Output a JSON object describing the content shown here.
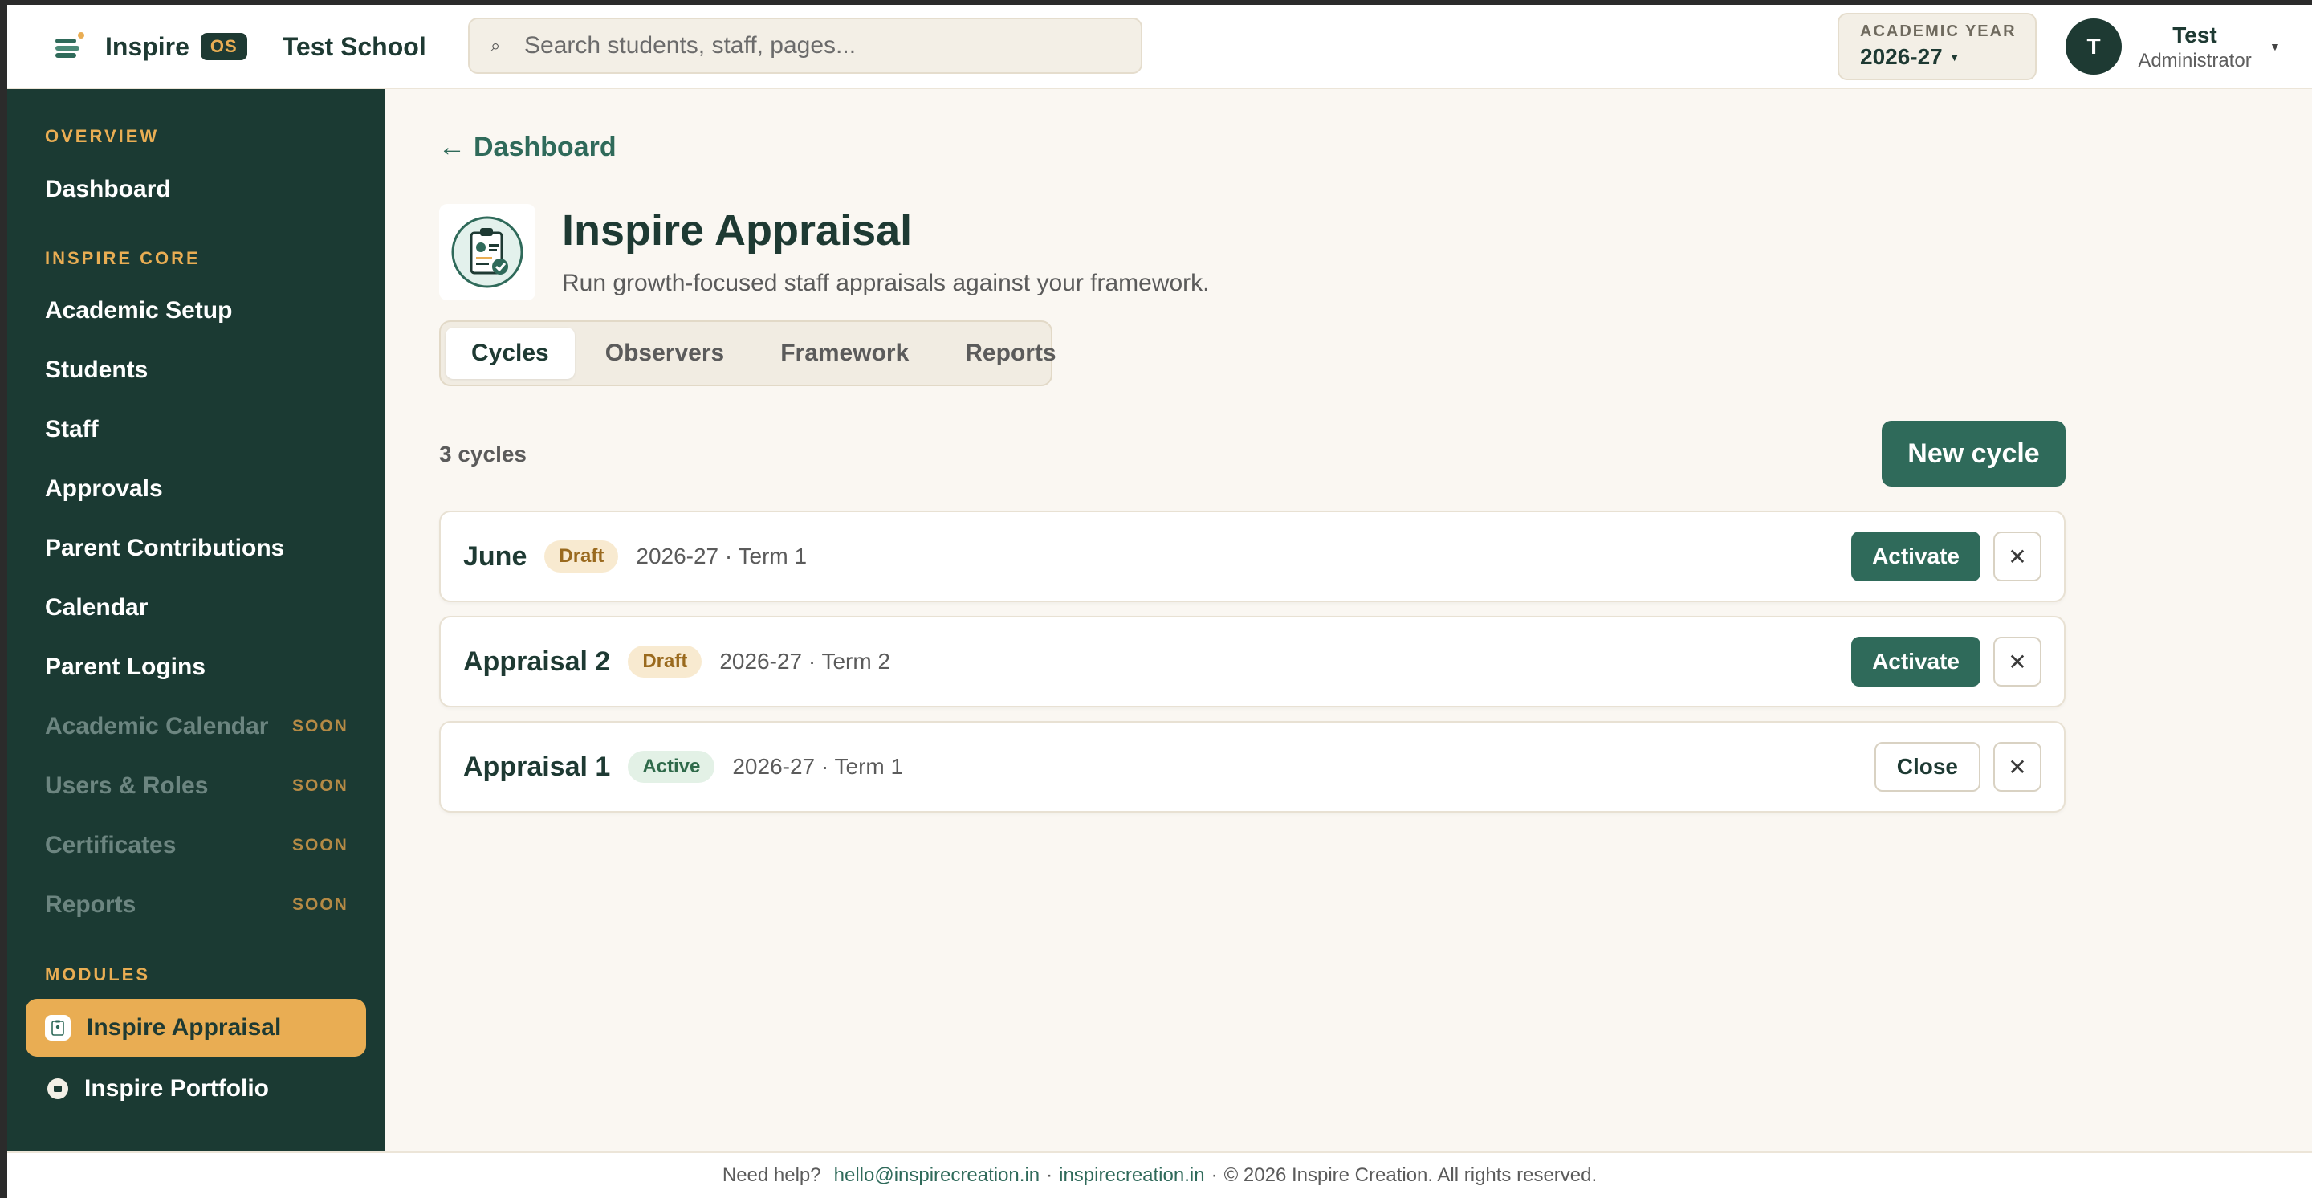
{
  "header": {
    "brand_name": "Inspire",
    "brand_badge": "OS",
    "school_name": "Test School",
    "search_placeholder": "Search students, staff, pages...",
    "search_icon": "⌕",
    "academic_year_label": "ACADEMIC YEAR",
    "academic_year_value": "2026-27",
    "user_initial": "T",
    "user_name": "Test",
    "user_role": "Administrator"
  },
  "sidebar": {
    "overview_label": "OVERVIEW",
    "overview_items": [
      "Dashboard"
    ],
    "core_label": "INSPIRE CORE",
    "core_items": [
      "Academic Setup",
      "Students",
      "Staff",
      "Approvals",
      "Parent Contributions",
      "Calendar",
      "Parent Logins"
    ],
    "soon_items": [
      "Academic Calendar",
      "Users & Roles",
      "Certificates",
      "Reports"
    ],
    "soon_tag": "SOON",
    "modules_label": "MODULES",
    "modules": [
      "Inspire Appraisal",
      "Inspire Portfolio"
    ]
  },
  "main": {
    "back_label": "Dashboard",
    "title": "Inspire Appraisal",
    "subtitle": "Run growth-focused staff appraisals against your framework.",
    "tabs": [
      "Cycles",
      "Observers",
      "Framework",
      "Reports"
    ],
    "count_label": "3 cycles",
    "new_button": "New cycle",
    "cycles": [
      {
        "name": "June",
        "status": "Draft",
        "meta": "2026-27 · Term 1",
        "action": "Activate"
      },
      {
        "name": "Appraisal 2",
        "status": "Draft",
        "meta": "2026-27 · Term 2",
        "action": "Activate"
      },
      {
        "name": "Appraisal 1",
        "status": "Active",
        "meta": "2026-27 · Term 1",
        "action": "Close"
      }
    ]
  },
  "footer": {
    "help_label": "Need help?",
    "email": "hello@inspirecreation.in",
    "site": "inspirecreation.in",
    "copyright": "© 2026 Inspire Creation. All rights reserved."
  },
  "colors": {
    "brand_dark": "#1b3a33",
    "accent": "#e9ad53",
    "primary_button": "#2f6a5a"
  }
}
